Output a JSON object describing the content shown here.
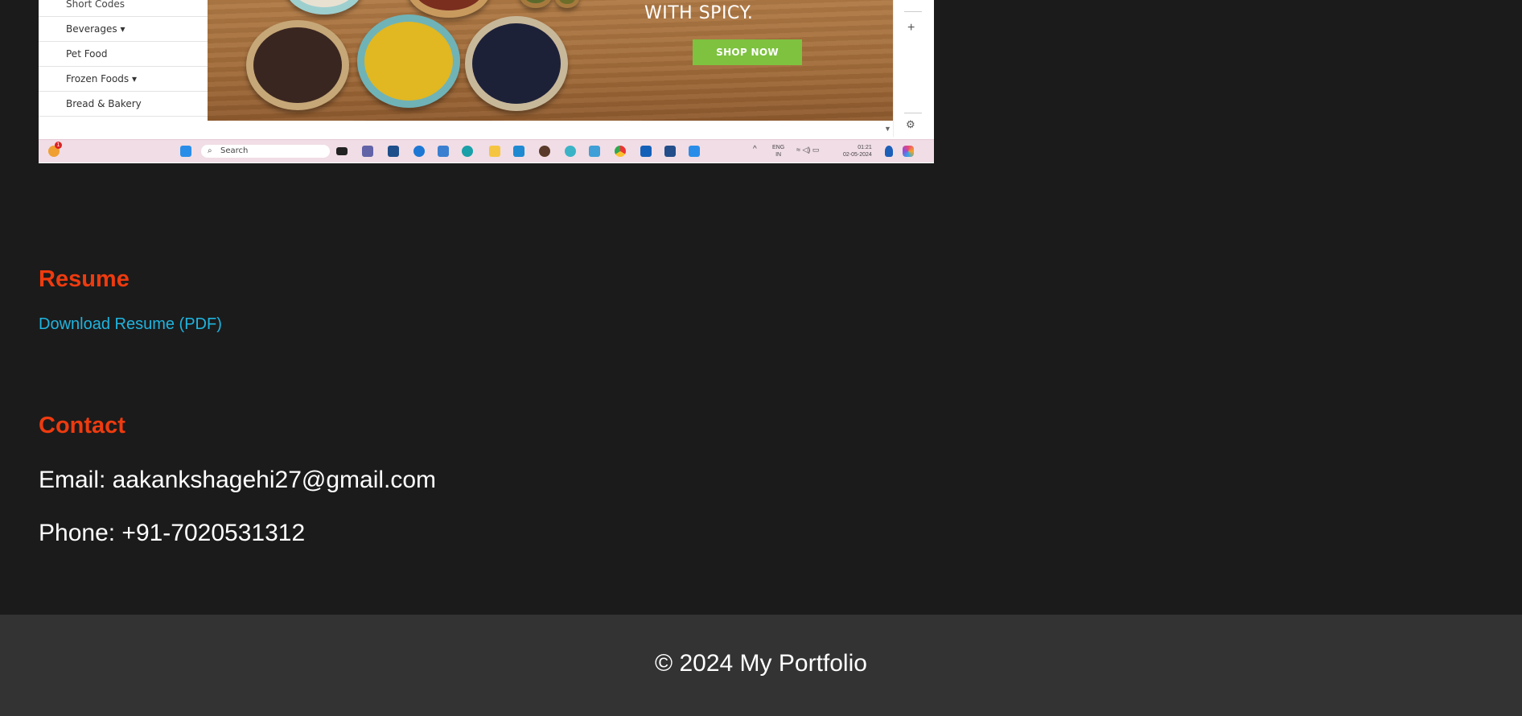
{
  "screenshot": {
    "sidebar_items": [
      "Short Codes",
      "Beverages ▾",
      "Pet Food",
      "Frozen Foods ▾",
      "Bread & Bakery"
    ],
    "banner_text": "WITH SPICY.",
    "shop_button": "SHOP NOW",
    "taskbar": {
      "search_placeholder": "Search",
      "lang_line1": "ENG",
      "lang_line2": "IN",
      "time": "01:21",
      "date": "02-05-2024",
      "notification_count": "1"
    },
    "icons": [
      "plus-icon",
      "settings-icon",
      "windows-start-icon",
      "search-icon"
    ]
  },
  "resume": {
    "title": "Resume",
    "link_label": "Download Resume (PDF)"
  },
  "contact": {
    "title": "Contact",
    "email_line": "Email: aakankshagehi27@gmail.com",
    "phone_line": "Phone: +91-7020531312"
  },
  "footer": {
    "text": "© 2024 My Portfolio"
  },
  "colors": {
    "background": "#1b1b1b",
    "heading_accent": "#ee3b0f",
    "link": "#1fb4df",
    "footer_bg": "#333333",
    "shop_button": "#7ec23f"
  }
}
